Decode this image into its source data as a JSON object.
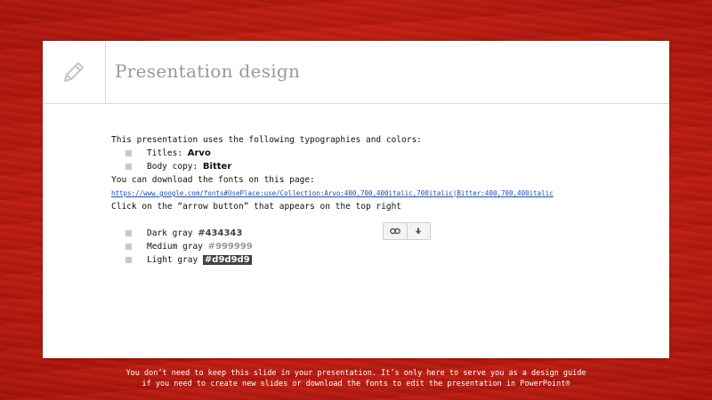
{
  "slide": {
    "title": "Presentation design",
    "intro": "This presentation uses the following typographies and colors:",
    "fonts": [
      {
        "label": "Titles: ",
        "value": "Arvo"
      },
      {
        "label": "Body copy: ",
        "value": "Bitter"
      }
    ],
    "download_text": "You can download the fonts on this page:",
    "download_link": "https://www.google.com/fonts#UsePlace:use/Collection:Arvo:400,700,400italic,700italic|Bitter:400,700,400italic",
    "arrow_text": "Click on the “arrow button” that appears on the top right",
    "colors": [
      {
        "label": "Dark gray ",
        "value": "#434343",
        "hex": "#434343"
      },
      {
        "label": "Medium gray ",
        "value": "#999999",
        "hex": "#999999"
      },
      {
        "label": "Light gray ",
        "value": "#d9d9d9",
        "hex": "#d9d9d9"
      }
    ],
    "icon": "pencil-icon"
  },
  "toolbar": {
    "buttons": [
      {
        "icon": "link-icon"
      },
      {
        "icon": "download-arrow-icon"
      }
    ]
  },
  "footer": {
    "line1": "You don’t need to keep this slide in your presentation. It’s only here to serve you as a design guide",
    "line2": "if you need to create new slides or download the fonts to edit the presentation in PowerPoint®"
  },
  "theme": {
    "background": "#c01e12",
    "card": "#ffffff",
    "title_color": "#999999",
    "link_color": "#1a4fb5"
  }
}
